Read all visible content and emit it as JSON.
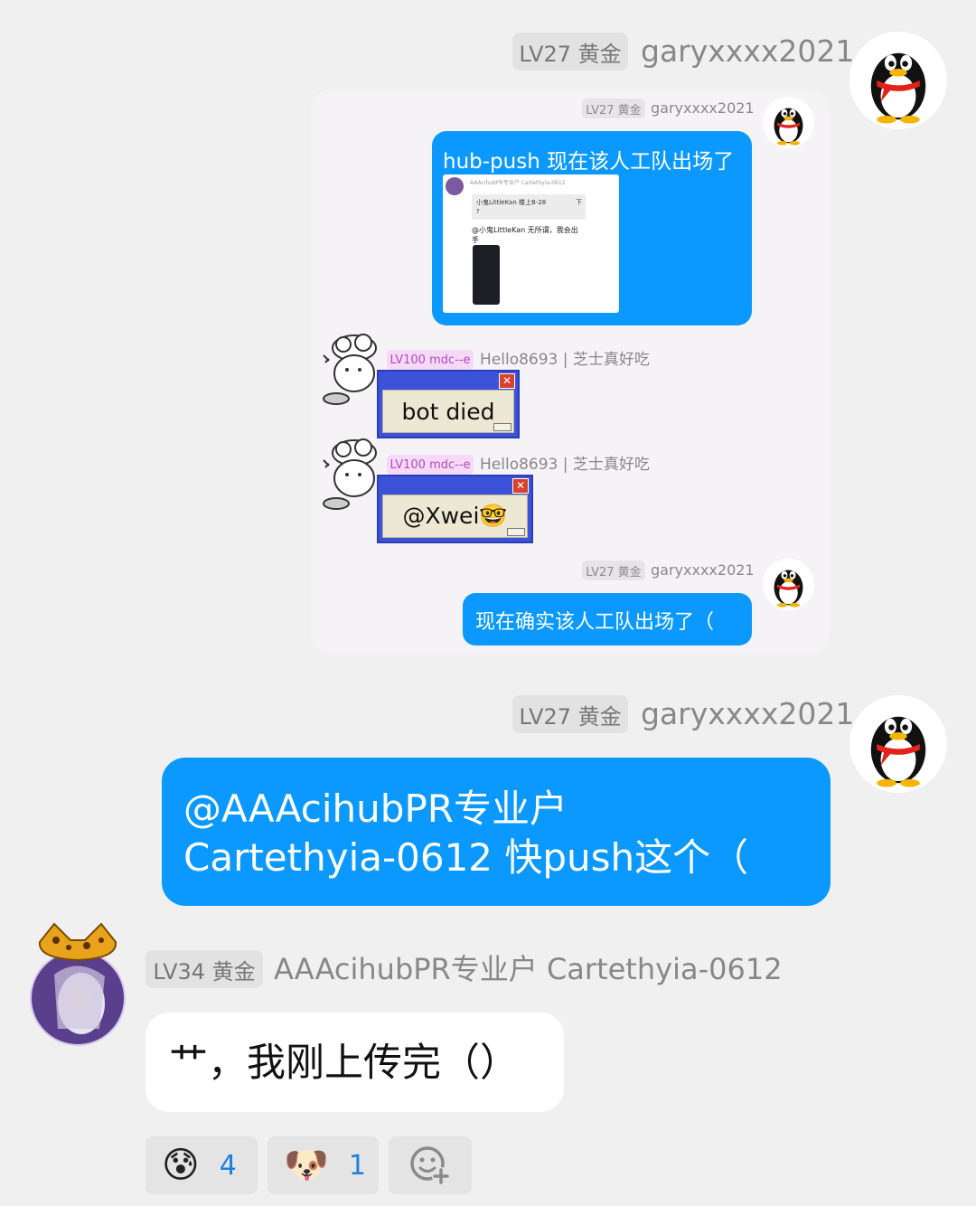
{
  "messages": {
    "m1": {
      "badge": "LV27 黄金",
      "name": "garyxxxx2021"
    },
    "forward": {
      "f1": {
        "badge": "LV27 黄金",
        "name": "garyxxxx2021",
        "text": "hub-push 现在该人工队出场了"
      },
      "screenshot": {
        "header": "AAAcihubPR专业户 Cartethyia-0612",
        "quote": "小鬼LittleKan 楼上B-28",
        "quote_tail": "下",
        "quote_mark": "?",
        "reply": "@小鬼LittleKan 无所谓，我会出手"
      },
      "f2": {
        "badge": "LV100 mdc--e",
        "name": "Hello8693 | 芝士真好吃",
        "text": "bot died"
      },
      "f3": {
        "badge": "LV100 mdc--e",
        "name": "Hello8693 | 芝士真好吃",
        "text": "@Xwei🤓"
      },
      "f4": {
        "badge": "LV27 黄金",
        "name": "garyxxxx2021",
        "text": "现在确实该人工队出场了（"
      }
    },
    "m2": {
      "badge": "LV27 黄金",
      "name": "garyxxxx2021",
      "line1": "@AAAcihubPR专业户",
      "line2": "Cartethyia-0612 快push这个（"
    },
    "m3": {
      "badge": "LV34 黄金",
      "name": "AAAcihubPR专业户 Cartethyia-0612",
      "text": "艹，我刚上传完（）"
    }
  },
  "reactions": [
    {
      "emoji": "😰",
      "count": "4"
    },
    {
      "emoji": "🐶",
      "count": "1"
    }
  ],
  "icons": {
    "avatar_self": "qq-penguin-icon",
    "avatar_chef": "chef-doodle-icon",
    "avatar_anime": "anime-girl-icon",
    "add_reaction": "add-reaction-icon"
  },
  "colors": {
    "accent": "#0b99ff",
    "background": "#f0f0f0"
  }
}
